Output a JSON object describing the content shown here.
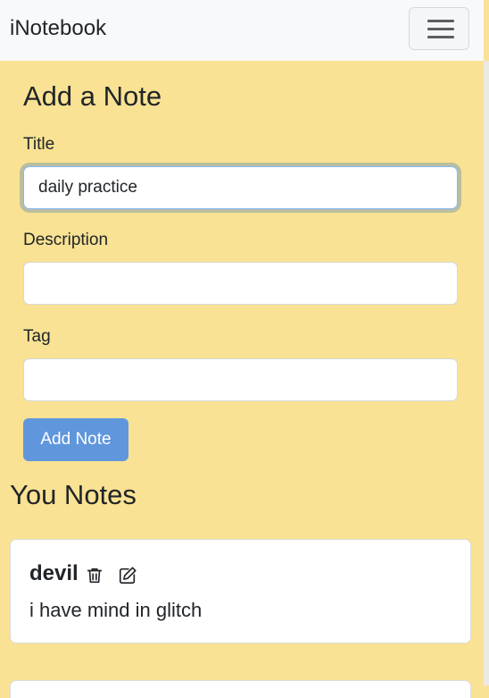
{
  "navbar": {
    "brand": "iNotebook",
    "toggler_icon": "hamburger-menu-icon"
  },
  "add_note": {
    "heading": "Add a Note",
    "title_label": "Title",
    "title_value": "daily practice",
    "description_label": "Description",
    "description_value": "",
    "tag_label": "Tag",
    "tag_value": "",
    "submit_label": "Add Note"
  },
  "notes": {
    "heading": "You Notes",
    "items": [
      {
        "title": "devil",
        "description": "i have mind in glitch",
        "delete_icon": "trash-icon",
        "edit_icon": "edit-icon"
      }
    ]
  },
  "colors": {
    "page_background": "#f9e293",
    "navbar_background": "#f8f9fa",
    "button_primary": "#6097dc"
  }
}
